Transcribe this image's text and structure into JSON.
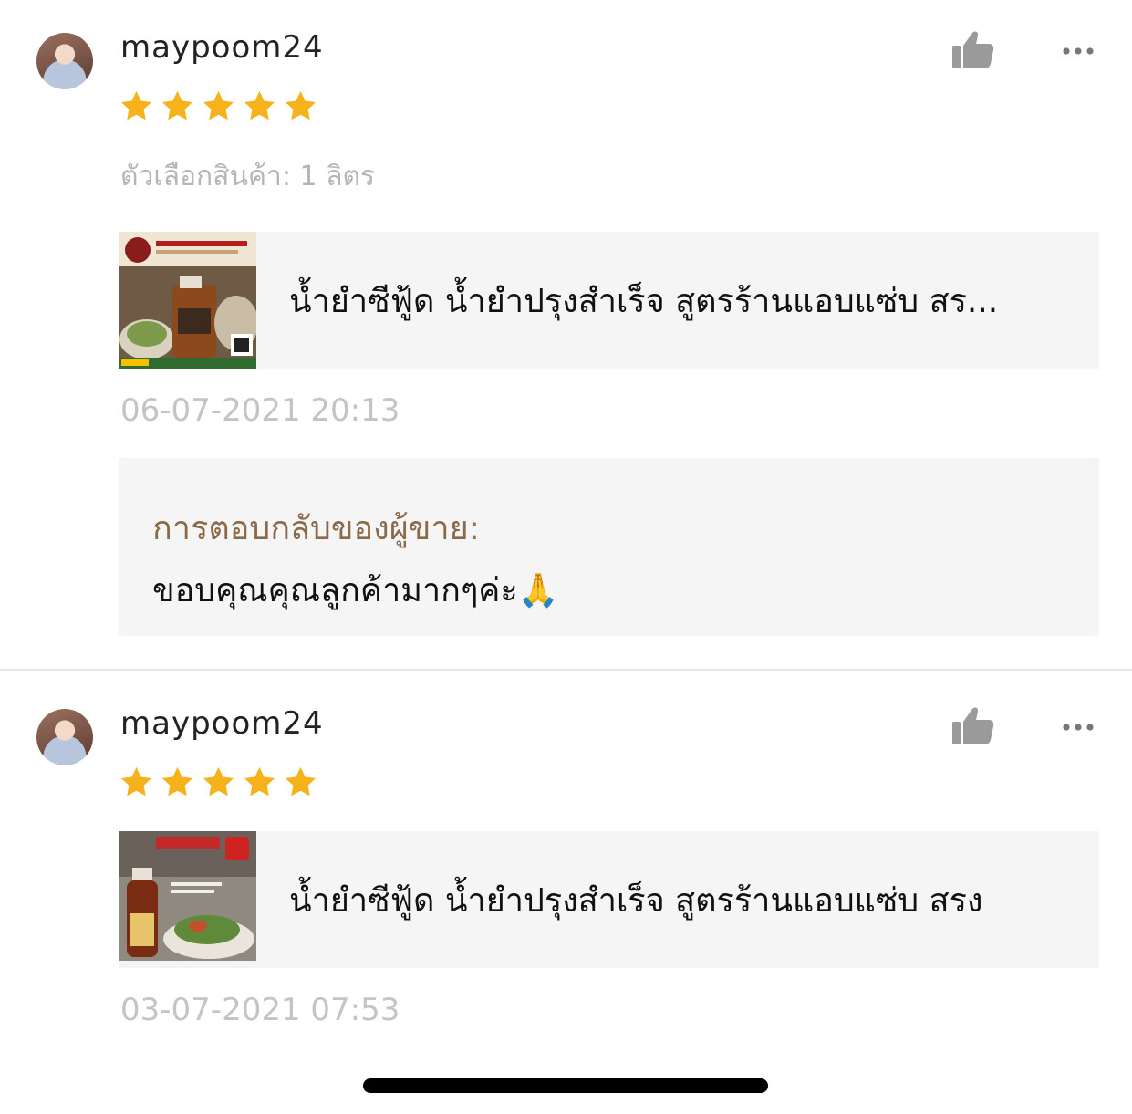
{
  "reviews": [
    {
      "username": "maypoom24",
      "rating": 5,
      "variant": "ตัวเลือกสินค้า: 1 ลิตร",
      "product_name": "น้ำยำซีฟู้ด น้ำยำปรุงสำเร็จ สูตรร้านแอบแซ่บ สร...",
      "timestamp": "06-07-2021 20:13",
      "seller_reply": {
        "title": "การตอบกลับของผู้ขาย:",
        "text": "ขอบคุณคุณลูกค้ามากๆค่ะ🙏"
      }
    },
    {
      "username": "maypoom24",
      "rating": 5,
      "product_name": "น้ำยำซีฟู้ด น้ำยำปรุงสำเร็จ สูตรร้านแอบแซ่บ สรง",
      "timestamp": "03-07-2021 07:53"
    }
  ],
  "colors": {
    "star": "#f6b21a",
    "reply_title": "#8b6a4a",
    "muted_text": "#b5b5b5",
    "icon_gray": "#9a9a9a"
  },
  "icons": {
    "like": "thumbs-up-icon",
    "more": "more-options-icon",
    "star": "star-icon"
  }
}
